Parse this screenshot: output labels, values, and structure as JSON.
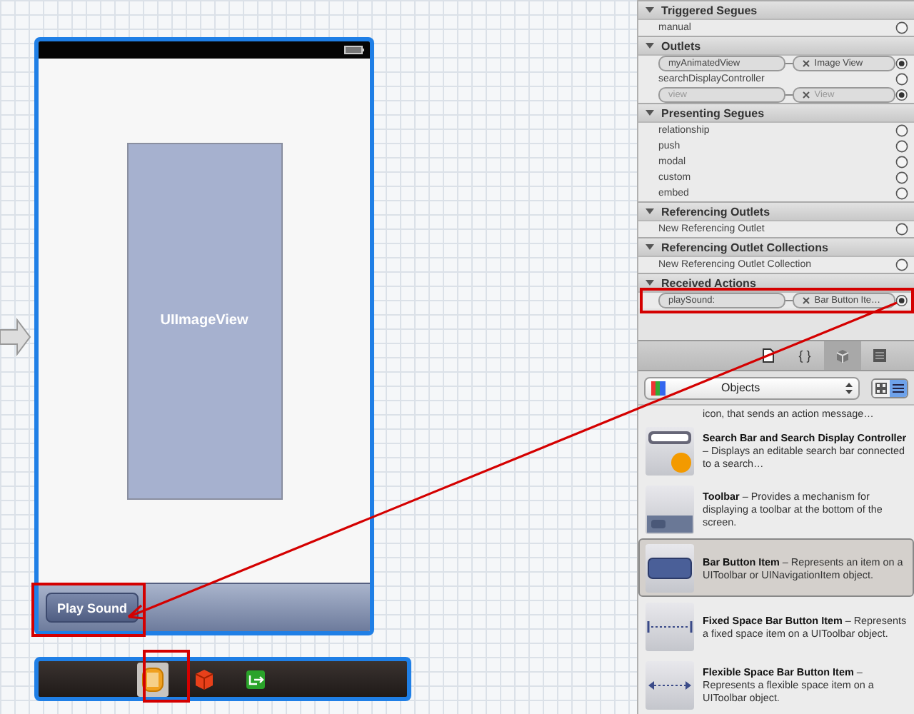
{
  "canvas": {
    "image_view": {
      "label": "UIImageView"
    },
    "toolbar": {
      "button": "Play Sound"
    },
    "dock": [
      {
        "kind": "view-controller",
        "selected": true
      },
      {
        "kind": "first-responder",
        "selected": false
      },
      {
        "kind": "exit",
        "selected": false
      }
    ]
  },
  "connections_inspector": {
    "sections": [
      {
        "title": "Triggered Segues",
        "expanded": true,
        "rows": [
          {
            "label": "manual",
            "connected": false,
            "disabled": false
          }
        ]
      },
      {
        "title": "Outlets",
        "expanded": true,
        "rows": [
          {
            "label": "myAnimatedView",
            "connected": true,
            "target": "Image View",
            "disabled": false
          },
          {
            "label": "searchDisplayController",
            "connected": false,
            "disabled": false
          },
          {
            "label": "view",
            "connected": true,
            "target": "View",
            "disabled": true
          }
        ]
      },
      {
        "title": "Presenting Segues",
        "expanded": true,
        "rows": [
          {
            "label": "relationship",
            "connected": false,
            "disabled": false
          },
          {
            "label": "push",
            "connected": false,
            "disabled": false
          },
          {
            "label": "modal",
            "connected": false,
            "disabled": false
          },
          {
            "label": "custom",
            "connected": false,
            "disabled": false
          },
          {
            "label": "embed",
            "connected": false,
            "disabled": false
          }
        ]
      },
      {
        "title": "Referencing Outlets",
        "expanded": true,
        "rows": [
          {
            "label": "New Referencing Outlet",
            "connected": false,
            "disabled": false
          }
        ]
      },
      {
        "title": "Referencing Outlet Collections",
        "expanded": true,
        "rows": [
          {
            "label": "New Referencing Outlet Collection",
            "connected": false,
            "disabled": false
          }
        ]
      },
      {
        "title": "Received Actions",
        "expanded": true,
        "rows": [
          {
            "label": "playSound:",
            "connected": true,
            "target": "Bar Button Ite…",
            "disabled": false
          }
        ]
      }
    ]
  },
  "library": {
    "tabs": [
      {
        "kind": "file",
        "selected": false
      },
      {
        "kind": "code",
        "label": "{ }",
        "selected": false
      },
      {
        "kind": "object",
        "selected": true
      },
      {
        "kind": "media",
        "selected": false
      }
    ],
    "selector": {
      "value": "Objects"
    },
    "view_modes": [
      {
        "kind": "grid",
        "selected": false
      },
      {
        "kind": "list",
        "selected": true
      }
    ],
    "items": [
      {
        "kind": "button",
        "text": "icon, that sends an action message…",
        "selected": false
      },
      {
        "kind": "search-bar",
        "text": "**Search Bar and Search Display Controller** – Displays an editable search bar connected to a search…",
        "selected": false
      },
      {
        "kind": "toolbar",
        "text": "**Toolbar** – Provides a mechanism for displaying a toolbar at the bottom of the screen.",
        "selected": false
      },
      {
        "kind": "bar-button",
        "text": "**Bar Button Item** – Represents an item on a UIToolbar or UINavigationItem object.",
        "selected": true
      },
      {
        "kind": "fixed-space",
        "text": "**Fixed Space Bar Button Item** – Represents a fixed space item on a UIToolbar object.",
        "selected": false
      },
      {
        "kind": "flexible-space",
        "text": "**Flexible Space Bar Button Item** – Represents a flexible space item on a UIToolbar object.",
        "selected": false
      }
    ]
  }
}
